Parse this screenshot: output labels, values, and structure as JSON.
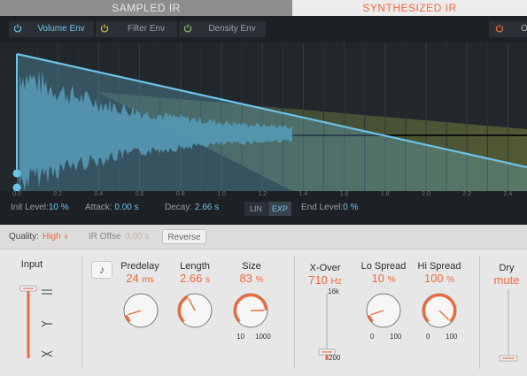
{
  "mode_tabs": {
    "sampled": "SAMPLED IR",
    "synthesized": "SYNTHESIZED IR"
  },
  "envelope_tabs": {
    "volume": "Volume Env",
    "filter": "Filter Env",
    "density": "Density Env",
    "right_partial": "O"
  },
  "axis_ticks": [
    "0.0",
    "0.2",
    "0.4",
    "0.6",
    "0.8",
    "1.0",
    "1.2",
    "1.4",
    "1.6",
    "1.8",
    "2.0",
    "2.2",
    "2.4"
  ],
  "envelope_params": {
    "init_level_label": "Init Level:",
    "init_level_value": "10 %",
    "attack_label": "Attack:",
    "attack_value": "0.00 s",
    "decay_label": "Decay:",
    "decay_value": "2.66 s",
    "end_level_label": "End Level:",
    "end_level_value": "0 %",
    "lin_label": "LIN",
    "exp_label": "EXP"
  },
  "quality_bar": {
    "quality_label": "Quality:",
    "quality_value": "High",
    "ir_offset_label": "IR Offse",
    "ir_offset_value": "0.00 s",
    "reverse_label": "Reverse"
  },
  "input": {
    "label": "Input"
  },
  "predelay": {
    "label": "Predelay",
    "value": "24",
    "unit": "ms",
    "level": 0.1
  },
  "length": {
    "label": "Length",
    "value": "2.66",
    "unit": "s",
    "level": 0.4
  },
  "size": {
    "label": "Size",
    "value": "83",
    "unit": "%",
    "level": 0.83,
    "min": "10",
    "max": "1000"
  },
  "xover": {
    "label": "X-Over",
    "value": "710",
    "unit": "Hz",
    "top_label": "16k",
    "bottom_label": "200",
    "level": 0.12
  },
  "lo_spread": {
    "label": "Lo Spread",
    "value": "10",
    "unit": "%",
    "level": 0.1,
    "min": "0",
    "max": "100"
  },
  "hi_spread": {
    "label": "Hi Spread",
    "value": "100",
    "unit": "%",
    "level": 1.0,
    "min": "0",
    "max": "100"
  },
  "dry": {
    "label": "Dry",
    "value": "mute"
  },
  "colors": {
    "accent": "#ee6a3c",
    "env_blue": "#6cc4ea",
    "display_bg": "#1d2024"
  },
  "icons": {
    "envelope_power": "power-icon",
    "note": "note-icon",
    "input_routes": [
      "equal-route-icon",
      "merge-route-icon",
      "swap-route-icon"
    ]
  }
}
